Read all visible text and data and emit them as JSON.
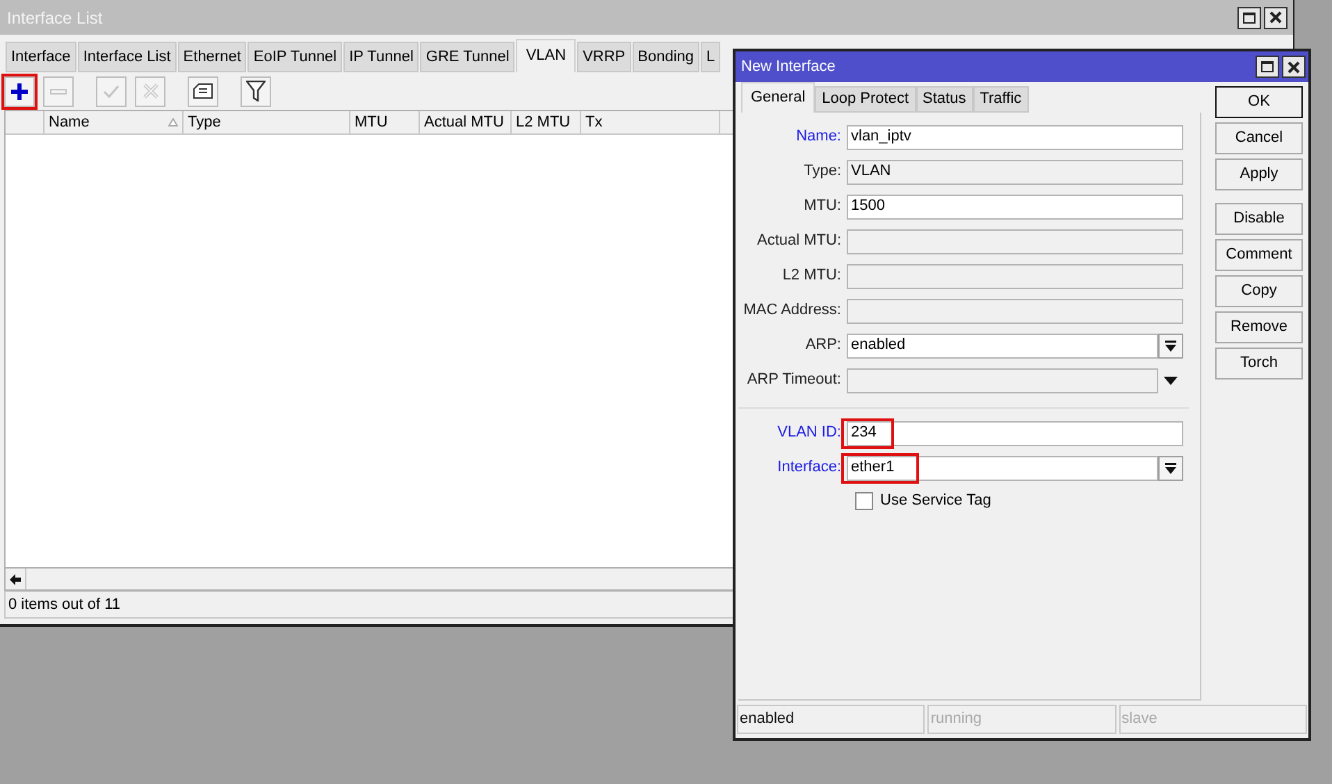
{
  "main_window": {
    "title": "Interface List",
    "tabs": [
      {
        "label": "Interface",
        "selected": false
      },
      {
        "label": "Interface List",
        "selected": false
      },
      {
        "label": "Ethernet",
        "selected": false
      },
      {
        "label": "EoIP Tunnel",
        "selected": false
      },
      {
        "label": "IP Tunnel",
        "selected": false
      },
      {
        "label": "GRE Tunnel",
        "selected": false
      },
      {
        "label": "VLAN",
        "selected": true
      },
      {
        "label": "VRRP",
        "selected": false
      },
      {
        "label": "Bonding",
        "selected": false
      },
      {
        "label": "L",
        "selected": false
      }
    ],
    "toolbar": [
      {
        "kind": "add",
        "disabled": false,
        "highlighted": true
      },
      {
        "kind": "remove",
        "disabled": true,
        "highlighted": false
      },
      {
        "kind": "enable",
        "disabled": true,
        "highlighted": false
      },
      {
        "kind": "disable",
        "disabled": true,
        "highlighted": false
      },
      {
        "kind": "comment",
        "disabled": false,
        "highlighted": false
      },
      {
        "kind": "filter",
        "disabled": false,
        "highlighted": false
      }
    ],
    "table": {
      "columns": [
        {
          "sorted": false
        },
        {
          "label": "Name",
          "sorted": true
        },
        {
          "label": "Type",
          "sorted": false
        },
        {
          "label": "MTU",
          "sorted": false
        },
        {
          "label": "Actual MTU",
          "sorted": false
        },
        {
          "label": "L2 MTU",
          "sorted": false
        },
        {
          "label": "Tx",
          "sorted": false
        }
      ]
    },
    "status": "0 items out of 11"
  },
  "dialog": {
    "title": "New Interface",
    "tabs": [
      {
        "label": "General",
        "selected": true
      },
      {
        "label": "Loop Protect",
        "selected": false
      },
      {
        "label": "Status",
        "selected": false
      },
      {
        "label": "Traffic",
        "selected": false
      }
    ],
    "sections": [
      [
        {
          "label": "Name:",
          "kind": "text",
          "value": "vlan_iptv",
          "required": true,
          "highlighted": false
        },
        {
          "label": "Type:",
          "kind": "readonly",
          "value": "VLAN",
          "required": false,
          "highlighted": false
        },
        {
          "label": "MTU:",
          "kind": "text",
          "value": "1500",
          "required": false,
          "highlighted": false
        },
        {
          "label": "Actual MTU:",
          "kind": "readonly",
          "required": false,
          "highlighted": false
        },
        {
          "label": "L2 MTU:",
          "kind": "readonly",
          "required": false,
          "highlighted": false
        },
        {
          "label": "MAC Address:",
          "kind": "readonly",
          "required": false,
          "highlighted": false
        },
        {
          "label": "ARP:",
          "kind": "dropdown",
          "value": "enabled",
          "required": false,
          "highlighted": false
        },
        {
          "label": "ARP Timeout:",
          "kind": "readonly-dropdown",
          "required": false,
          "highlighted": false
        }
      ],
      [
        {
          "label": "VLAN ID:",
          "kind": "text",
          "value": "234",
          "required": true,
          "highlighted": true
        },
        {
          "label": "Interface:",
          "kind": "dropdown",
          "value": "ether1",
          "required": true,
          "highlighted": true
        },
        {
          "label": "Use Service Tag",
          "kind": "checkbox",
          "checked": false
        }
      ]
    ],
    "button_groups": [
      [
        {
          "label": "OK",
          "default": true
        },
        {
          "label": "Cancel",
          "default": false
        },
        {
          "label": "Apply",
          "default": false
        }
      ],
      [
        {
          "label": "Disable",
          "default": false
        },
        {
          "label": "Comment",
          "default": false
        },
        {
          "label": "Copy",
          "default": false
        },
        {
          "label": "Remove",
          "default": false
        },
        {
          "label": "Torch",
          "default": false
        }
      ]
    ],
    "status": [
      {
        "label": "enabled",
        "disabled": false
      },
      {
        "label": "running",
        "disabled": true
      },
      {
        "label": "slave",
        "disabled": true
      }
    ]
  }
}
